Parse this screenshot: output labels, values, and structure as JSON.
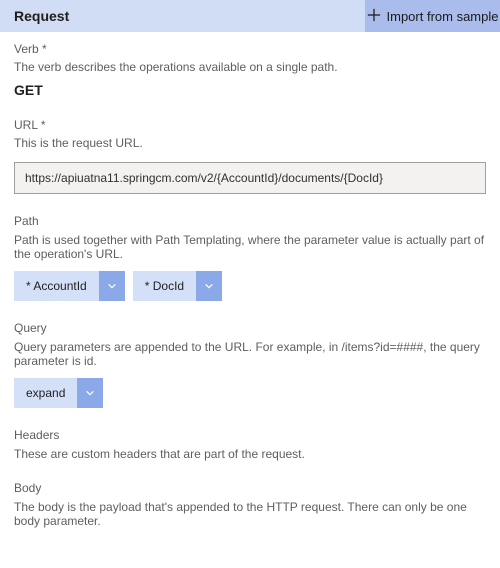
{
  "header": {
    "title": "Request",
    "import_label": "Import from sample"
  },
  "verb": {
    "label": "Verb *",
    "desc": "The verb describes the operations available on a single path.",
    "value": "GET"
  },
  "url": {
    "label": "URL *",
    "desc": "This is the request URL.",
    "value": "https://apiuatna11.springcm.com/v2/{AccountId}/documents/{DocId}"
  },
  "path": {
    "label": "Path",
    "desc": "Path is used together with Path Templating, where the parameter value is actually part of the operation's URL.",
    "chips": [
      {
        "label": "* AccountId"
      },
      {
        "label": "* DocId"
      }
    ]
  },
  "query": {
    "label": "Query",
    "desc": "Query parameters are appended to the URL. For example, in /items?id=####, the query parameter is id.",
    "chips": [
      {
        "label": "expand"
      }
    ]
  },
  "headers": {
    "label": "Headers",
    "desc": "These are custom headers that are part of the request."
  },
  "bodysec": {
    "label": "Body",
    "desc": "The body is the payload that's appended to the HTTP request. There can only be one body parameter."
  }
}
